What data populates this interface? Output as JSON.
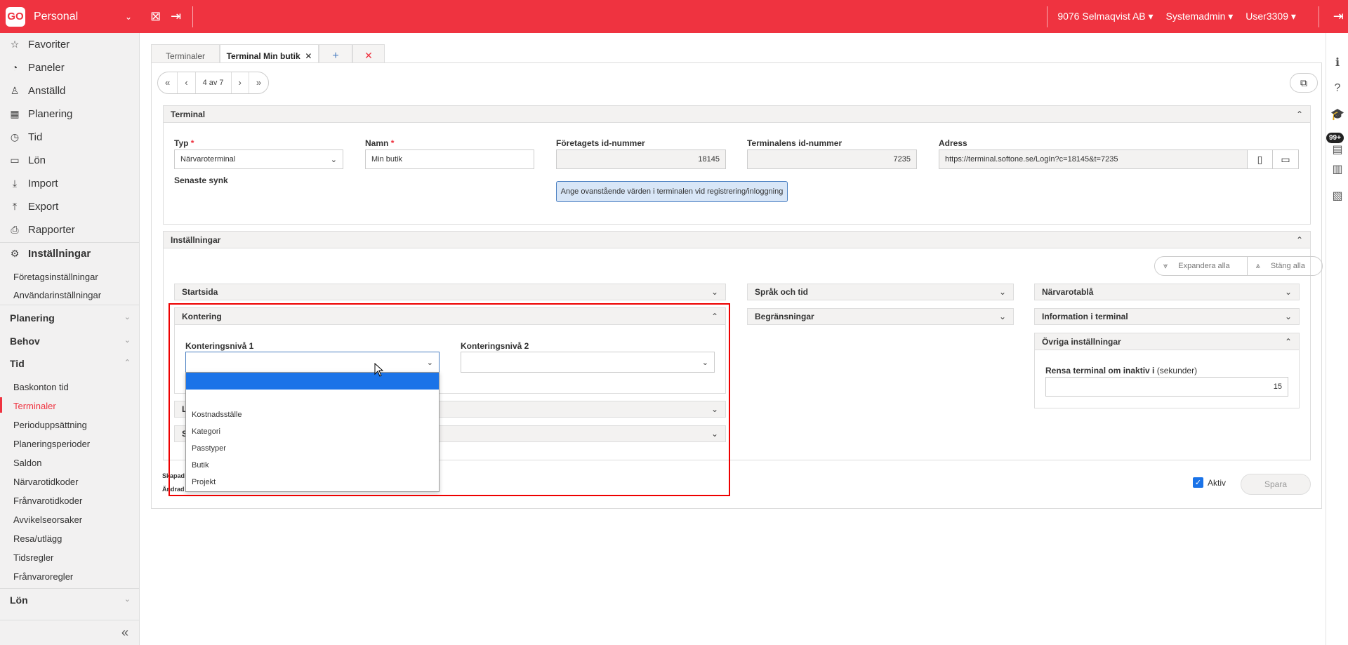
{
  "topbar": {
    "logo": "GO",
    "module": "Personal",
    "company": "9076 Selmaqvist AB",
    "role": "Systemadmin",
    "user": "User3309"
  },
  "sidebar": {
    "items": [
      {
        "icon": "star-icon",
        "glyph": "☆",
        "label": "Favoriter"
      },
      {
        "icon": "gauge-icon",
        "glyph": "◔",
        "label": "Paneler"
      },
      {
        "icon": "user-icon",
        "glyph": "♙",
        "label": "Anställd"
      },
      {
        "icon": "calendar-icon",
        "glyph": "▦",
        "label": "Planering"
      },
      {
        "icon": "clock-icon",
        "glyph": "◷",
        "label": "Tid"
      },
      {
        "icon": "money-icon",
        "glyph": "▭",
        "label": "Lön"
      },
      {
        "icon": "import-icon",
        "glyph": "⤓",
        "label": "Import"
      },
      {
        "icon": "export-icon",
        "glyph": "⤒",
        "label": "Export"
      },
      {
        "icon": "printer-icon",
        "glyph": "⎙",
        "label": "Rapporter"
      }
    ],
    "settings_label": "Inställningar",
    "settings_sub": [
      "Företagsinställningar",
      "Användarinställningar"
    ],
    "groups": {
      "planering": "Planering",
      "behov": "Behov",
      "tid": "Tid",
      "lon": "Lön"
    },
    "tid_sub": [
      "Baskonton tid",
      "Terminaler",
      "Perioduppsättning",
      "Planeringsperioder",
      "Saldon",
      "Närvarotidkoder",
      "Frånvarotidkoder",
      "Avvikelseorsaker",
      "Resa/utlägg",
      "Tidsregler",
      "Frånvaroregler"
    ]
  },
  "tabs": {
    "list": "Terminaler",
    "current": "Terminal Min butik"
  },
  "pager": {
    "position": "4 av 7"
  },
  "terminal_section": {
    "title": "Terminal",
    "typ_label": "Typ",
    "typ_value": "Närvaroterminal",
    "namn_label": "Namn",
    "namn_value": "Min butik",
    "foretag_label": "Företagets id-nummer",
    "foretag_value": "18145",
    "terminal_id_label": "Terminalens id-nummer",
    "terminal_id_value": "7235",
    "adress_label": "Adress",
    "adress_value": "https://terminal.softone.se/LogIn?c=18145&t=7235",
    "senaste_synk_label": "Senaste synk",
    "info_button": "Ange ovanstående värden i terminalen vid registrering/inloggning"
  },
  "settings_section": {
    "title": "Inställningar",
    "expand_all": "Expandera alla",
    "close_all": "Stäng alla",
    "startsida": "Startsida",
    "sprak": "Språk och tid",
    "narvarotabla": "Närvarotablå",
    "kontering": "Kontering",
    "begransningar": "Begränsningar",
    "info_terminal": "Information i terminal",
    "ovriga": "Övriga inställningar",
    "kontering_niva1": "Konteringsnivå 1",
    "kontering_niva2": "Konteringsnivå 2",
    "rensa_label": "Rensa terminal om inaktiv i",
    "rensa_unit": "(sekunder)",
    "rensa_value": "15",
    "hidden_sec1_initial": "L",
    "hidden_sec2_initial": "S"
  },
  "dropdown": {
    "options": [
      "",
      "",
      "Kostnadsställe",
      "Kategori",
      "Passtyper",
      "Butik",
      "Projekt"
    ]
  },
  "footer": {
    "skapad": "Skapad",
    "andrad": "Ändrad",
    "aktiv_label": "Aktiv",
    "save_label": "Spara"
  }
}
